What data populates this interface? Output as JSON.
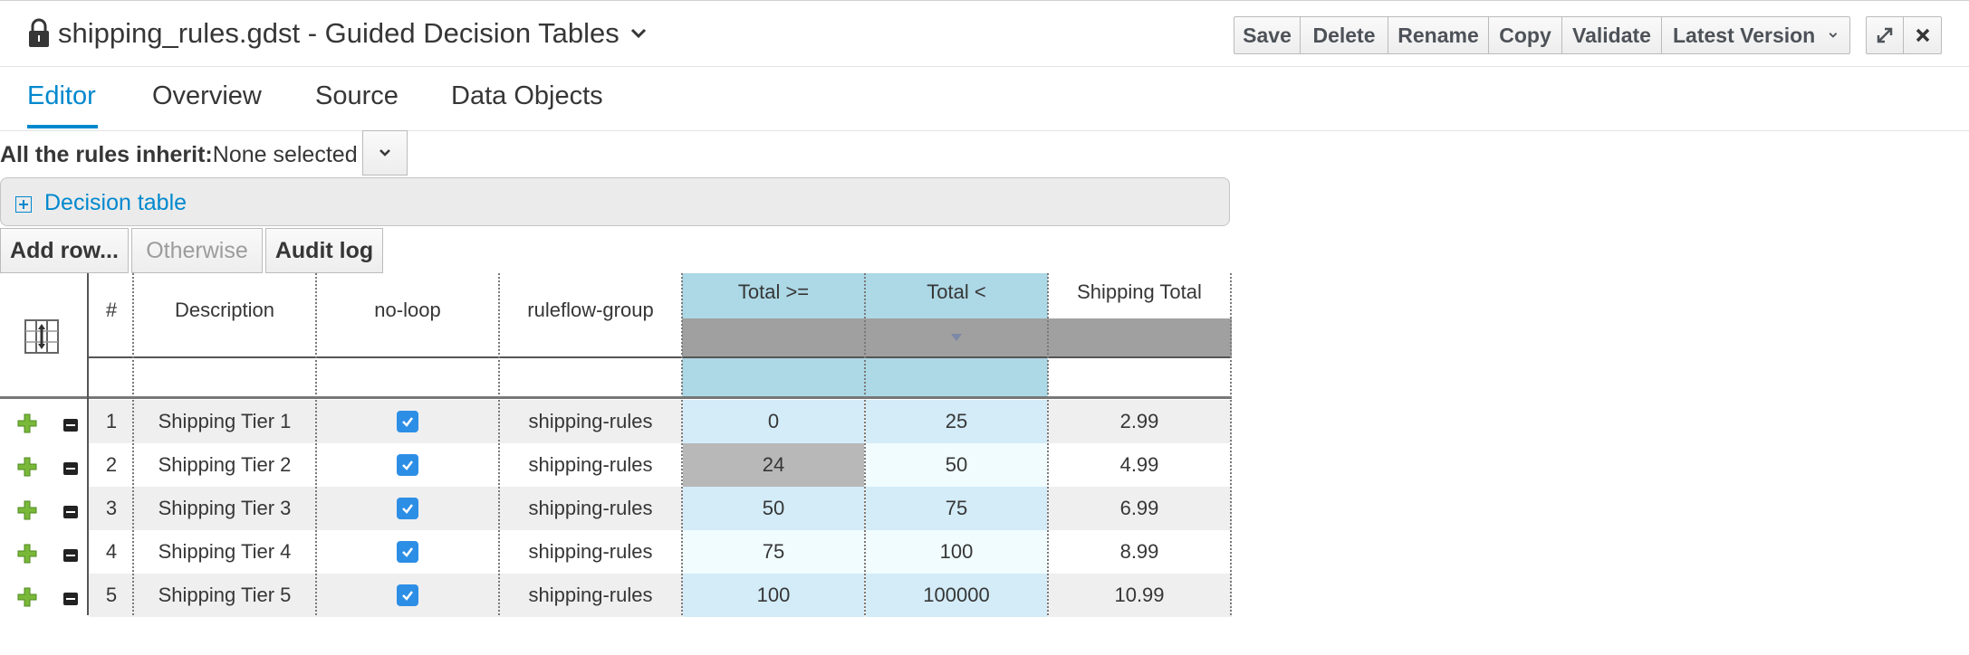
{
  "header": {
    "title": "shipping_rules.gdst - Guided Decision Tables",
    "buttons": [
      "Save",
      "Delete",
      "Rename",
      "Copy",
      "Validate",
      "Latest Version"
    ]
  },
  "tabs": [
    {
      "label": "Editor",
      "active": true
    },
    {
      "label": "Overview",
      "active": false
    },
    {
      "label": "Source",
      "active": false
    },
    {
      "label": "Data Objects",
      "active": false
    }
  ],
  "inherit": {
    "label": "All the rules inherit:",
    "value": "None selected"
  },
  "decision_table": {
    "label": "Decision table"
  },
  "actions": {
    "add_row": "Add row...",
    "otherwise": "Otherwise",
    "audit_log": "Audit log"
  },
  "columns": {
    "num": "#",
    "description": "Description",
    "no_loop": "no-loop",
    "ruleflow_group": "ruleflow-group",
    "total_gte": "Total >=",
    "total_lt": "Total <",
    "shipping_total": "Shipping Total"
  },
  "rows": [
    {
      "num": "1",
      "description": "Shipping Tier 1",
      "no_loop": true,
      "ruleflow_group": "shipping-rules",
      "total_gte": "0",
      "total_lt": "25",
      "shipping_total": "2.99"
    },
    {
      "num": "2",
      "description": "Shipping Tier 2",
      "no_loop": true,
      "ruleflow_group": "shipping-rules",
      "total_gte": "24",
      "total_lt": "50",
      "shipping_total": "4.99"
    },
    {
      "num": "3",
      "description": "Shipping Tier 3",
      "no_loop": true,
      "ruleflow_group": "shipping-rules",
      "total_gte": "50",
      "total_lt": "75",
      "shipping_total": "6.99"
    },
    {
      "num": "4",
      "description": "Shipping Tier 4",
      "no_loop": true,
      "ruleflow_group": "shipping-rules",
      "total_gte": "75",
      "total_lt": "100",
      "shipping_total": "8.99"
    },
    {
      "num": "5",
      "description": "Shipping Tier 5",
      "no_loop": true,
      "ruleflow_group": "shipping-rules",
      "total_gte": "100",
      "total_lt": "100000",
      "shipping_total": "10.99"
    }
  ],
  "colors": {
    "accent": "#0088ce",
    "condition_header": "#add8e6",
    "condition_cell": "#d3ecf8",
    "condition_cell_alt": "#f0fcfd",
    "selected_cell": "#b8b8b8",
    "pattern_bar": "#a0a0a0",
    "checkbox": "#2d8ee6"
  }
}
